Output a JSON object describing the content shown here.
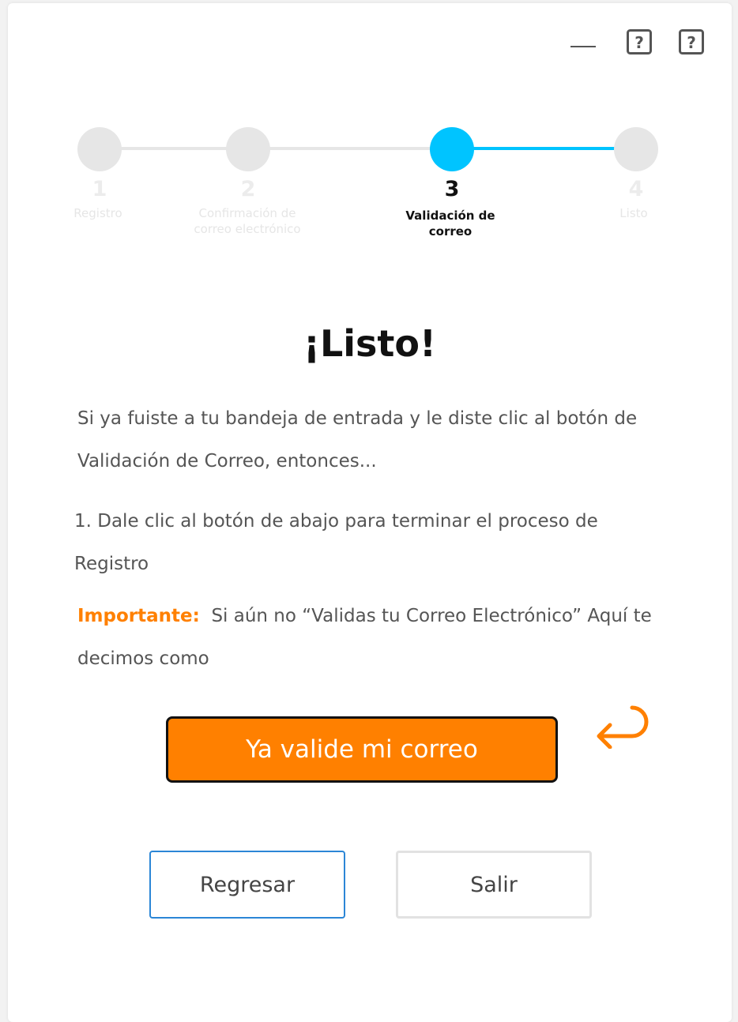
{
  "window_controls": {
    "minimize_icon": "minimize-icon",
    "help_icon": "help-icon"
  },
  "stepper": {
    "active_color": "#00c4ff",
    "inactive_color": "#e6e6e6",
    "steps": [
      {
        "number": "1",
        "label": "Registro",
        "state": "inactive"
      },
      {
        "number": "2",
        "label": "Confirmación de correo electrónico",
        "state": "inactive"
      },
      {
        "number": "3",
        "label": "Validación de correo",
        "state": "active"
      },
      {
        "number": "4",
        "label": "Listo",
        "state": "inactive"
      }
    ]
  },
  "content": {
    "title": "¡Listo!",
    "intro": "Si ya fuiste a tu bandeja de entrada y le diste clic al botón de Validación de Correo, entonces...",
    "step_instruction": "1. Dale clic al botón de abajo para terminar el proceso de Registro",
    "important_label": "Importante:",
    "important_text": "Si aún no “Validas tu Correo Electrónico”  Aquí te decimos como"
  },
  "actions": {
    "confirm_label": "Ya valide mi correo",
    "confirm_color": "#ff8000",
    "return_icon": "return-arrow-icon",
    "back_label": "Regresar",
    "exit_label": "Salir"
  }
}
